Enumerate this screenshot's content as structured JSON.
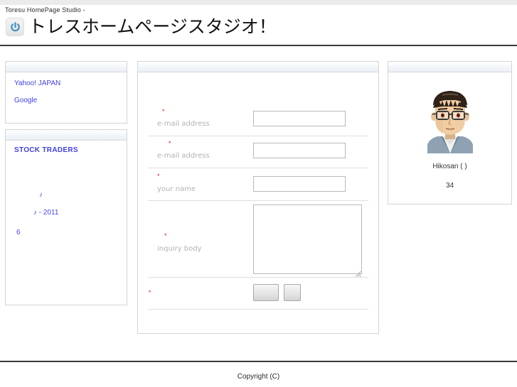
{
  "header": {
    "subtitle": "Toresu HomePage Studio  -",
    "title": "トレスホームページスタジオ！",
    "icon": "power-icon",
    "icon_color": "#3f8fc4",
    "rule_color": "#3a3a3a"
  },
  "sidebar": {
    "links_panel": {
      "items": [
        {
          "label": "Yahoo! JAPAN"
        },
        {
          "label": "Google"
        }
      ]
    },
    "stock_panel": {
      "heading": "STOCK TRADERS",
      "notes": [
        {
          "label": "♪"
        },
        {
          "label": "♪ - 2011"
        },
        {
          "label": "6"
        }
      ],
      "link_color": "#3f3fe8"
    }
  },
  "form": {
    "required_marker": "*",
    "required_color": "#e02020",
    "rows": [
      {
        "label": "e-mail address",
        "control": "text-input",
        "value": "",
        "placeholder": ""
      },
      {
        "label": "e-mail address",
        "control": "text-input",
        "value": "",
        "placeholder": ""
      },
      {
        "label": "your name",
        "control": "text-input",
        "value": "",
        "placeholder": ""
      },
      {
        "label": "inquiry body",
        "control": "textarea",
        "value": "",
        "placeholder": ""
      }
    ],
    "buttons": [
      {
        "label": ""
      },
      {
        "label": ""
      }
    ]
  },
  "profile": {
    "avatar": "male-avatar-with-glasses",
    "name": "Hikosan (   )",
    "age": "34"
  },
  "footer": {
    "copyright": "Copyright (C)"
  }
}
